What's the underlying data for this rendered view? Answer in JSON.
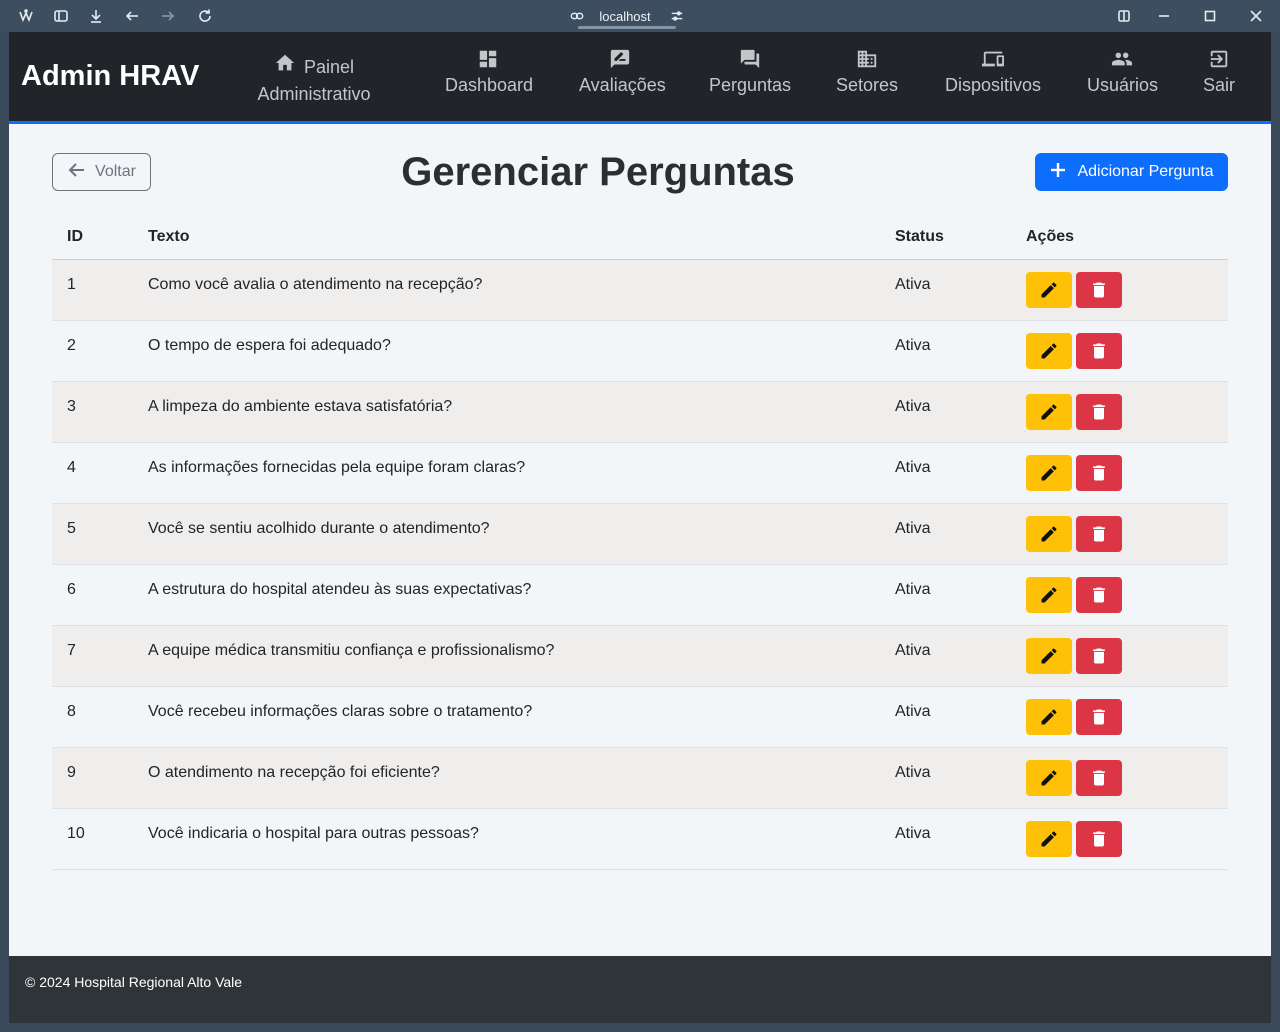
{
  "browser": {
    "address": "localhost",
    "icons": [
      "app-logo-icon",
      "sidebar-toggle-icon",
      "download-icon",
      "back-icon",
      "forward-icon",
      "reload-icon",
      "link-icon",
      "tune-icon",
      "split-view-icon",
      "minimize-icon",
      "maximize-icon",
      "close-icon"
    ]
  },
  "navbar": {
    "brand": "Admin HRAV",
    "items": [
      {
        "line1": "Painel",
        "line2": "Administrativo",
        "icon": "home-icon"
      },
      {
        "label": "Dashboard",
        "icon": "dashboard-icon"
      },
      {
        "label": "Avaliações",
        "icon": "rate-review-icon"
      },
      {
        "label": "Perguntas",
        "icon": "forum-icon"
      },
      {
        "label": "Setores",
        "icon": "business-icon"
      },
      {
        "label": "Dispositivos",
        "icon": "devices-icon"
      },
      {
        "label": "Usuários",
        "icon": "people-icon"
      },
      {
        "label": "Sair",
        "icon": "logout-icon"
      }
    ]
  },
  "page": {
    "back_label": "Voltar",
    "title": "Gerenciar Perguntas",
    "add_label": "Adicionar Pergunta"
  },
  "table": {
    "headers": {
      "id": "ID",
      "text": "Texto",
      "status": "Status",
      "actions": "Ações"
    },
    "rows": [
      {
        "id": "1",
        "text": "Como você avalia o atendimento na recepção?",
        "status": "Ativa"
      },
      {
        "id": "2",
        "text": "O tempo de espera foi adequado?",
        "status": "Ativa"
      },
      {
        "id": "3",
        "text": "A limpeza do ambiente estava satisfatória?",
        "status": "Ativa"
      },
      {
        "id": "4",
        "text": "As informações fornecidas pela equipe foram claras?",
        "status": "Ativa"
      },
      {
        "id": "5",
        "text": "Você se sentiu acolhido durante o atendimento?",
        "status": "Ativa"
      },
      {
        "id": "6",
        "text": "A estrutura do hospital atendeu às suas expectativas?",
        "status": "Ativa"
      },
      {
        "id": "7",
        "text": "A equipe médica transmitiu confiança e profissionalismo?",
        "status": "Ativa"
      },
      {
        "id": "8",
        "text": "Você recebeu informações claras sobre o tratamento?",
        "status": "Ativa"
      },
      {
        "id": "9",
        "text": "O atendimento na recepção foi eficiente?",
        "status": "Ativa"
      },
      {
        "id": "10",
        "text": "Você indicaria o hospital para outras pessoas?",
        "status": "Ativa"
      }
    ]
  },
  "footer": {
    "text": "© 2024 Hospital Regional Alto Vale"
  },
  "colors": {
    "primary": "#0d6efd",
    "warning": "#ffc107",
    "danger": "#dc3545",
    "navbar": "#212529",
    "footer": "#2f3439"
  }
}
